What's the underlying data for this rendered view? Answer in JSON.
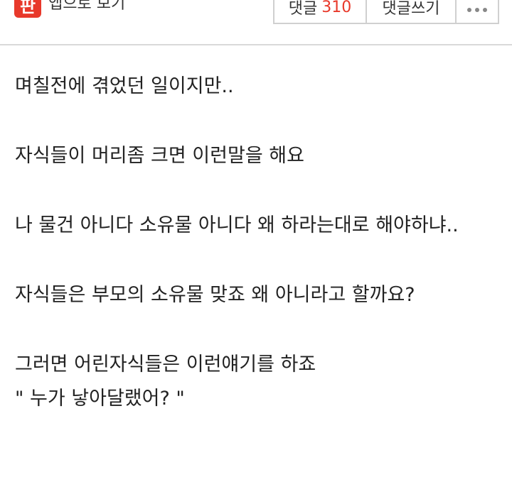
{
  "header": {
    "app_logo_text": "판",
    "app_link_label": "앱으로 보기",
    "comments_label": "댓글",
    "comments_count": "310",
    "write_comment_label": "댓글쓰기",
    "more_icon": "more-dots-icon"
  },
  "colors": {
    "accent": "#e8392b",
    "divider": "#d9d9d9"
  },
  "post": {
    "lines": [
      "며칠전에 겪었던 일이지만..",
      "자식들이 머리좀 크면 이런말을 해요",
      "나 물건 아니다 소유물 아니다 왜 하라는대로 해야하냐..",
      "자식들은 부모의 소유물 맞죠 왜 아니라고 할까요?",
      "그러면 어린자식들은 이런얘기를 하죠",
      "\" 누가 낳아달랬어? \""
    ]
  }
}
